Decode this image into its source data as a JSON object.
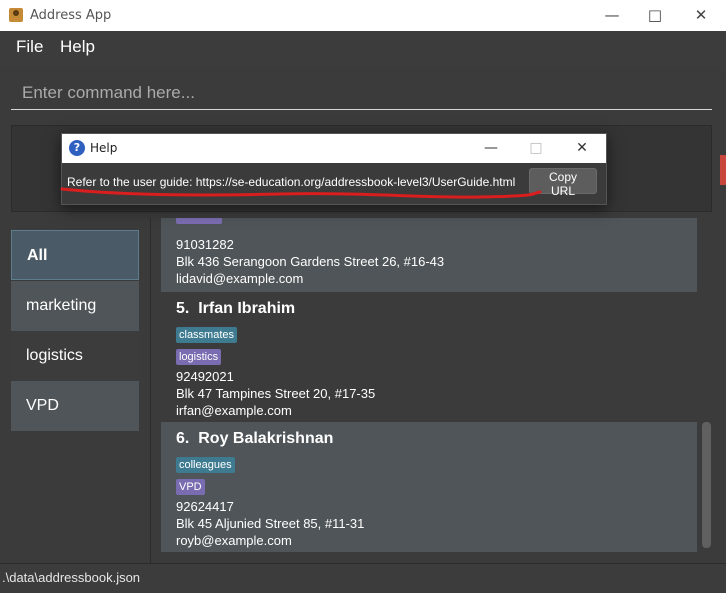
{
  "window": {
    "title": "Address App",
    "minimize_icon": "minimize-icon",
    "maximize_icon": "maximize-icon",
    "close_icon": "close-icon"
  },
  "menu": {
    "items": [
      "File",
      "Help"
    ]
  },
  "command": {
    "placeholder": "Enter command here..."
  },
  "tags_list": [
    {
      "label": "All",
      "selected": true
    },
    {
      "label": "marketing"
    },
    {
      "label": "logistics"
    },
    {
      "label": "VPD"
    }
  ],
  "persons": [
    {
      "tags": [],
      "phone": "91031282",
      "address": "Blk 436 Serangoon Gardens Street 26, #16-43",
      "email": "lidavid@example.com"
    },
    {
      "index": "5.",
      "name": "Irfan Ibrahim",
      "tags": [
        "classmates",
        "logistics"
      ],
      "phone": "92492021",
      "address": "Blk 47 Tampines Street 20, #17-35",
      "email": "irfan@example.com"
    },
    {
      "index": "6.",
      "name": "Roy Balakrishnan",
      "tags": [
        "colleagues",
        "VPD"
      ],
      "phone": "92624417",
      "address": "Blk 45 Aljunied Street 85, #11-31",
      "email": "royb@example.com"
    }
  ],
  "status": {
    "file_path": ".\\data\\addressbook.json"
  },
  "help_dialog": {
    "title": "Help",
    "message": "Refer to the user guide: https://se-education.org/addressbook-level3/UserGuide.html",
    "copy_button": "Copy URL"
  },
  "colors": {
    "accent_red": "#d81e1e",
    "tag_teal": "#3e7b91",
    "tag_purple": "#7a6cb0"
  }
}
